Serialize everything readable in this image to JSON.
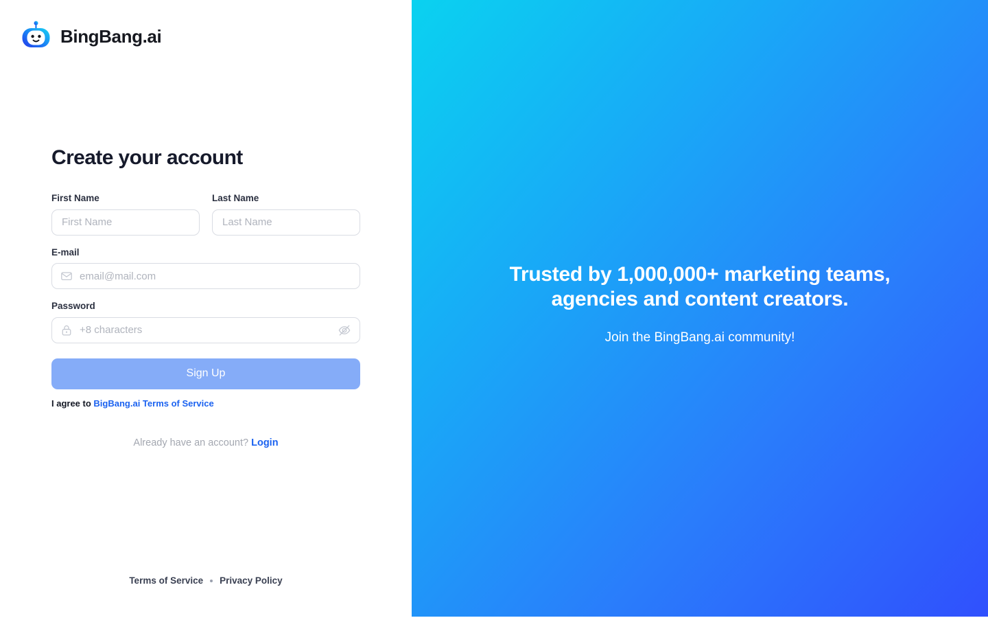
{
  "brand": {
    "name": "BingBang.ai",
    "logo_icon": "robot-head-icon"
  },
  "form": {
    "title": "Create your account",
    "fields": {
      "first_name": {
        "label": "First Name",
        "placeholder": "First Name",
        "value": ""
      },
      "last_name": {
        "label": "Last Name",
        "placeholder": "Last Name",
        "value": ""
      },
      "email": {
        "label": "E-mail",
        "placeholder": "email@mail.com",
        "value": "",
        "icon": "envelope-icon"
      },
      "password": {
        "label": "Password",
        "placeholder": "+8 characters",
        "value": "",
        "icon": "lock-icon",
        "toggle_icon": "eye-off-icon"
      }
    },
    "submit_label": "Sign Up",
    "agree_prefix": "I agree to ",
    "agree_link": "BigBang.ai Terms of Service",
    "have_account_text": "Already have an account?",
    "login_label": "Login"
  },
  "footer": {
    "terms": "Terms of Service",
    "separator": "·",
    "privacy": "Privacy Policy"
  },
  "promo": {
    "headline": "Trusted by 1,000,000+ marketing teams, agencies and content creators.",
    "subtext": "Join the BingBang.ai community!"
  },
  "colors": {
    "accent_link": "#1b62f0",
    "button_bg": "#85acf8",
    "gradient_start": "#0ad2f0",
    "gradient_end": "#3050fd",
    "title_text": "#161a2b",
    "placeholder": "#b0b4bd"
  }
}
